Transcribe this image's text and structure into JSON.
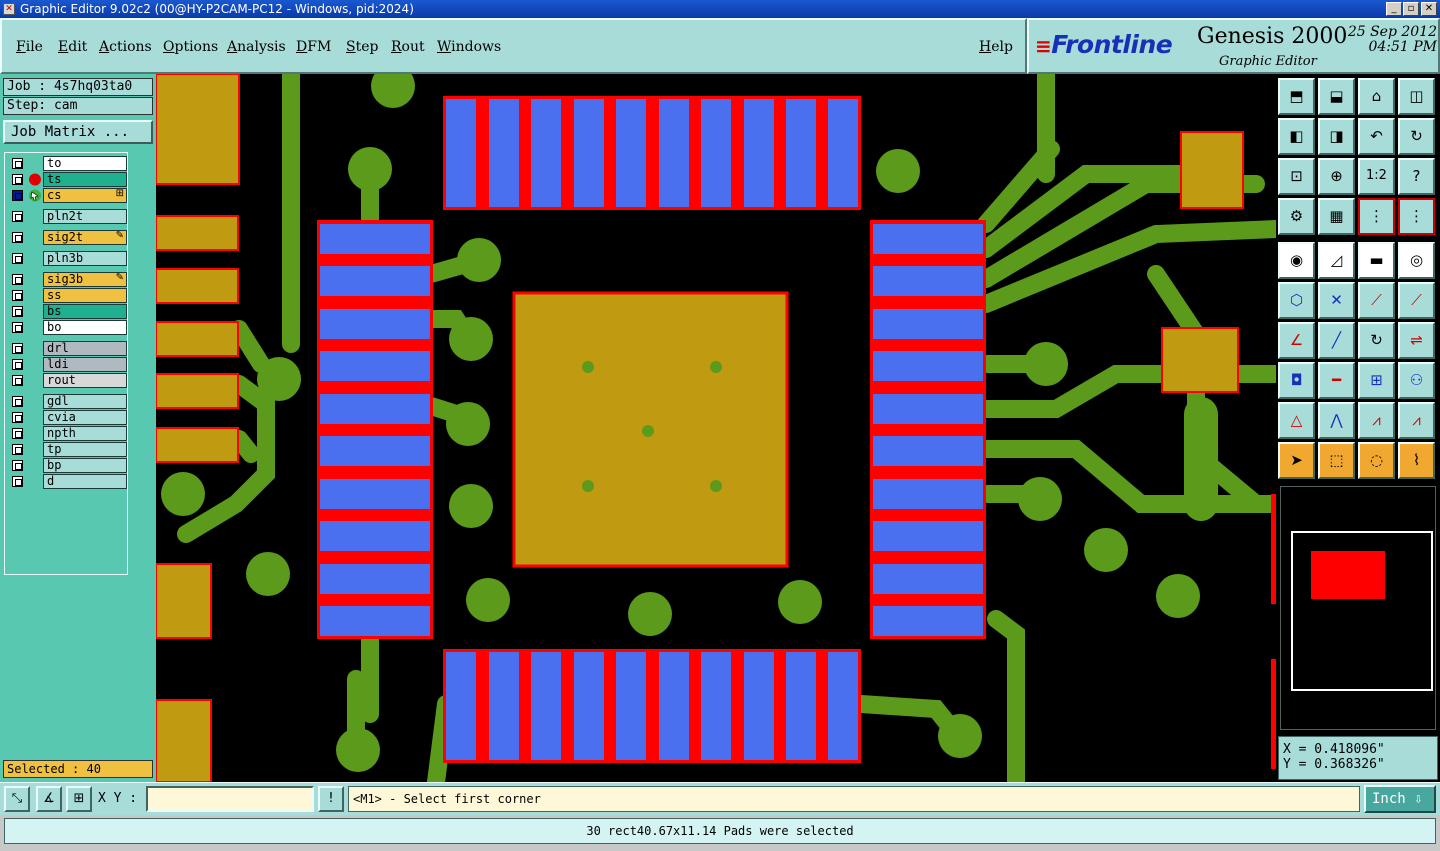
{
  "window": {
    "title": "Graphic Editor 9.02c2 (00@HY-P2CAM-PC12 - Windows, pid:2024)"
  },
  "menu": [
    "File",
    "Edit",
    "Actions",
    "Options",
    "Analysis",
    "DFM",
    "Step",
    "Rout",
    "Windows"
  ],
  "help": "Help",
  "brand": {
    "logo": "Frontline",
    "product": "Genesis 2000",
    "subtitle": "Graphic Editor",
    "date": "25 Sep 2012",
    "time": "04:51 PM"
  },
  "job": {
    "job": "Job : 4s7hq03ta0",
    "step": "Step: cam",
    "matrix": "Job Matrix ..."
  },
  "layers": [
    {
      "name": "to",
      "color": "#ffffff"
    },
    {
      "name": "ts",
      "color": "#20b090"
    },
    {
      "name": "cs",
      "color": "#f0c040"
    },
    {
      "name": "pln2t",
      "color": "#a8dcd8"
    },
    {
      "name": "sig2t",
      "color": "#f0c040"
    },
    {
      "name": "pln3b",
      "color": "#a8dcd8"
    },
    {
      "name": "sig3b",
      "color": "#f0c040"
    },
    {
      "name": "ss",
      "color": "#f0c040"
    },
    {
      "name": "bs",
      "color": "#20b090"
    },
    {
      "name": "bo",
      "color": "#ffffff"
    },
    {
      "name": "drl",
      "color": "#b0b8c0"
    },
    {
      "name": "ldi",
      "color": "#b0b8c0"
    },
    {
      "name": "rout",
      "color": "#d8d8d8"
    },
    {
      "name": "gdl",
      "color": "#a8dcd8"
    },
    {
      "name": "cvia",
      "color": "#a8dcd8"
    },
    {
      "name": "npth",
      "color": "#a8dcd8"
    },
    {
      "name": "tp",
      "color": "#a8dcd8"
    },
    {
      "name": "bp",
      "color": "#a8dcd8"
    },
    {
      "name": "d",
      "color": "#a8dcd8"
    }
  ],
  "selected": "Selected : 40",
  "coords": {
    "x": "X = 0.418096\"",
    "y": "Y = 0.368326\""
  },
  "xy_label": "X Y :",
  "xy_value": "",
  "prompt": "<M1> - Select first corner",
  "unit": "Inch",
  "status": "30 rect40.67x11.14 Pads were selected",
  "tools": {
    "ratio": "1:2"
  },
  "colors": {
    "board_bg": "#000000",
    "copper": "#5c9a1c",
    "pad_copper": "#c09a10",
    "pad_fill": "#4a70f0",
    "highlight": "#ff0000",
    "panel": "#a8dcd8",
    "panel_dark": "#58c8b0"
  }
}
